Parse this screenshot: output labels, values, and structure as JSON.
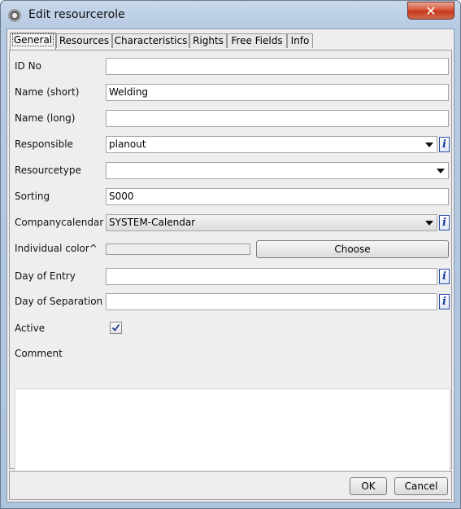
{
  "window": {
    "title": "Edit resourcerole",
    "close_label": "✕"
  },
  "tabs": [
    {
      "label": "General",
      "active": true
    },
    {
      "label": "Resources"
    },
    {
      "label": "Characteristics"
    },
    {
      "label": "Rights"
    },
    {
      "label": "Free Fields"
    },
    {
      "label": "Info"
    }
  ],
  "form": {
    "id_no": {
      "label": "ID No",
      "value": ""
    },
    "name_short": {
      "label": "Name (short)",
      "value": "Welding"
    },
    "name_long": {
      "label": "Name (long)",
      "value": ""
    },
    "responsible": {
      "label": "Responsible",
      "value": "planout"
    },
    "resourcetype": {
      "label": "Resourcetype",
      "value": ""
    },
    "sorting": {
      "label": "Sorting",
      "value": "S000"
    },
    "companycalendar": {
      "label": "Companycalendar",
      "value": "SYSTEM-Calendar"
    },
    "individual_color": {
      "label": "Individual color^",
      "button": "Choose"
    },
    "day_of_entry": {
      "label": "Day of Entry",
      "value": ""
    },
    "day_of_separation": {
      "label": "Day of Separation",
      "value": ""
    },
    "active": {
      "label": "Active",
      "checked": true
    },
    "comment": {
      "label": "Comment",
      "value": ""
    },
    "info_icon_glyph": "i"
  },
  "footer": {
    "ok_label": "OK",
    "cancel_label": "Cancel"
  },
  "colors": {
    "accent": "#2d4fa8",
    "close": "#c23a20"
  }
}
